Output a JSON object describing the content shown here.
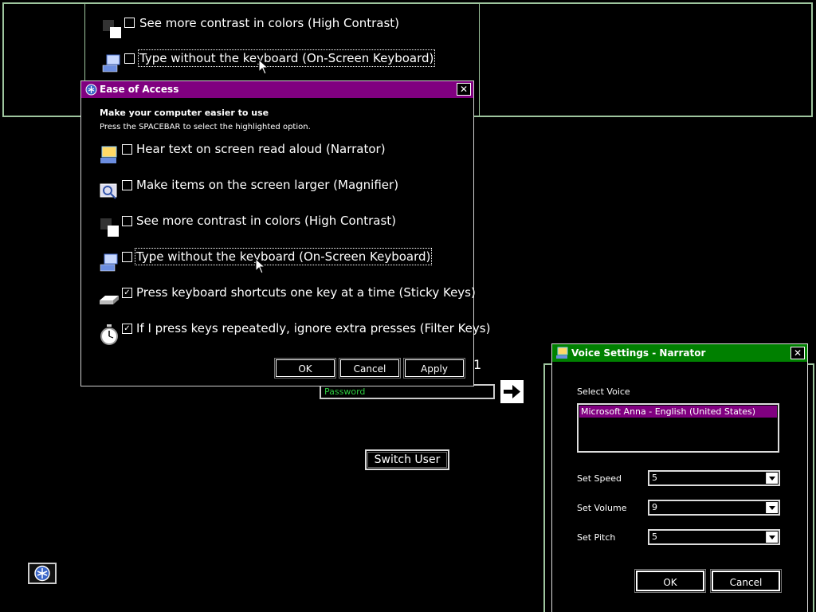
{
  "background_window": {
    "options": [
      {
        "label": "See more contrast in colors (High Contrast)",
        "checked": false,
        "icon": "high-contrast-icon"
      },
      {
        "label": "Type without the keyboard (On-Screen Keyboard)",
        "checked": false,
        "icon": "keyboard-computer-icon"
      }
    ]
  },
  "ease_of_access": {
    "title": "Ease of Access",
    "close_symbol": "✕",
    "heading": "Make your computer easier to use",
    "subheading": "Press the SPACEBAR to select the highlighted option.",
    "options": [
      {
        "label": "Hear text on screen read aloud (Narrator)",
        "checked": false,
        "check_symbol": "",
        "icon": "narrator-icon"
      },
      {
        "label": "Make items on the screen larger (Magnifier)",
        "checked": false,
        "check_symbol": "",
        "icon": "magnifier-icon"
      },
      {
        "label": "See more contrast in colors (High Contrast)",
        "checked": false,
        "check_symbol": "",
        "icon": "high-contrast-icon"
      },
      {
        "label": "Type without the keyboard (On-Screen Keyboard)",
        "checked": false,
        "check_symbol": "",
        "icon": "keyboard-computer-icon"
      },
      {
        "label": "Press keyboard shortcuts one key at a time (Sticky Keys)",
        "checked": true,
        "check_symbol": "✓",
        "icon": "sticky-keys-icon"
      },
      {
        "label": "If I press keys repeatedly, ignore extra presses (Filter Keys)",
        "checked": true,
        "check_symbol": "✓",
        "icon": "stopwatch-icon"
      }
    ],
    "buttons": {
      "ok": "OK",
      "cancel": "Cancel",
      "apply": "Apply"
    },
    "title_color": "#800080"
  },
  "logon": {
    "partial_char": "1",
    "password_placeholder": "Password",
    "switch_user": "Switch User"
  },
  "voice_settings": {
    "title": "Voice Settings - Narrator",
    "close_symbol": "✕",
    "select_voice_label": "Select Voice",
    "voices": [
      "Microsoft Anna - English (United States)"
    ],
    "speed_label": "Set Speed",
    "speed_value": "5",
    "volume_label": "Set Volume",
    "volume_value": "9",
    "pitch_label": "Set Pitch",
    "pitch_value": "5",
    "buttons": {
      "ok": "OK",
      "cancel": "Cancel"
    },
    "title_color": "#008000"
  }
}
